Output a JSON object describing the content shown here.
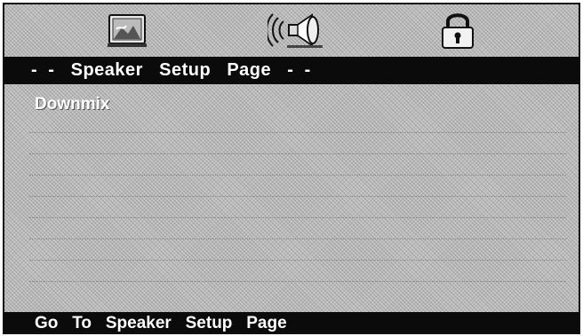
{
  "tabs": [
    {
      "icon": "picture-icon"
    },
    {
      "icon": "speaker-icon"
    },
    {
      "icon": "lock-icon"
    }
  ],
  "title": "-  -   Speaker   Setup   Page   -  -",
  "menu": {
    "items": [
      {
        "label": "Downmix"
      }
    ]
  },
  "status": "Go   To   Speaker   Setup   Page",
  "colors": {
    "bar_background": "#0b0b0b",
    "text": "#ffffff",
    "screen_background": "#c9c9c9"
  }
}
